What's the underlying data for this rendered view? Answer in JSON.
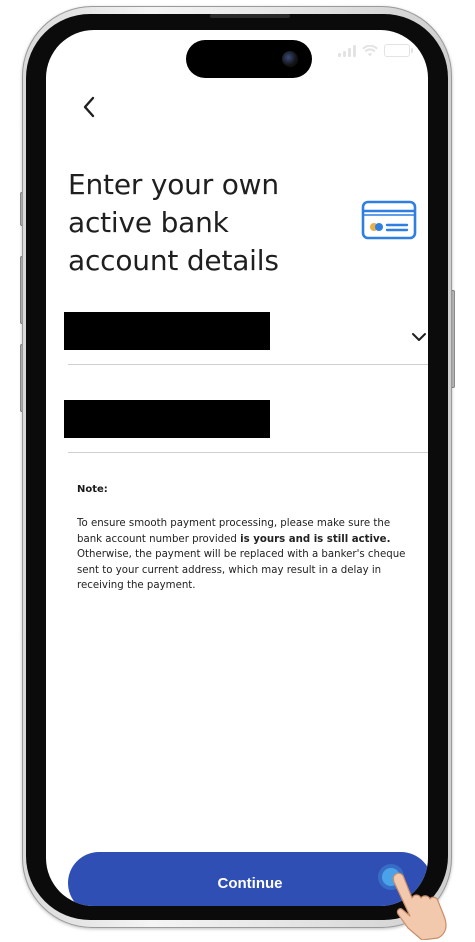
{
  "header": {
    "back_icon": "chevron-left-icon"
  },
  "page": {
    "title": "Enter your own active bank account details",
    "card_icon": "bank-card-icon"
  },
  "form": {
    "field_1": {
      "value": "",
      "redacted": true,
      "icon": "chevron-down-icon"
    },
    "field_2": {
      "value": "",
      "redacted": true
    }
  },
  "note": {
    "label": "Note:",
    "text_part_1": "To ensure smooth payment processing, please make sure the bank account number provided ",
    "text_bold": "is yours and is still active.",
    "text_part_2": " Otherwise, the payment will be replaced with a banker's cheque sent to your current address, which may result in a delay in receiving the payment."
  },
  "footer": {
    "continue_label": "Continue"
  },
  "colors": {
    "primary": "#2f4fb4",
    "card_icon_blue": "#2f7fe0",
    "card_icon_gold": "#e7b04a",
    "text": "#1f1f1f",
    "divider": "#cfcfcf"
  }
}
